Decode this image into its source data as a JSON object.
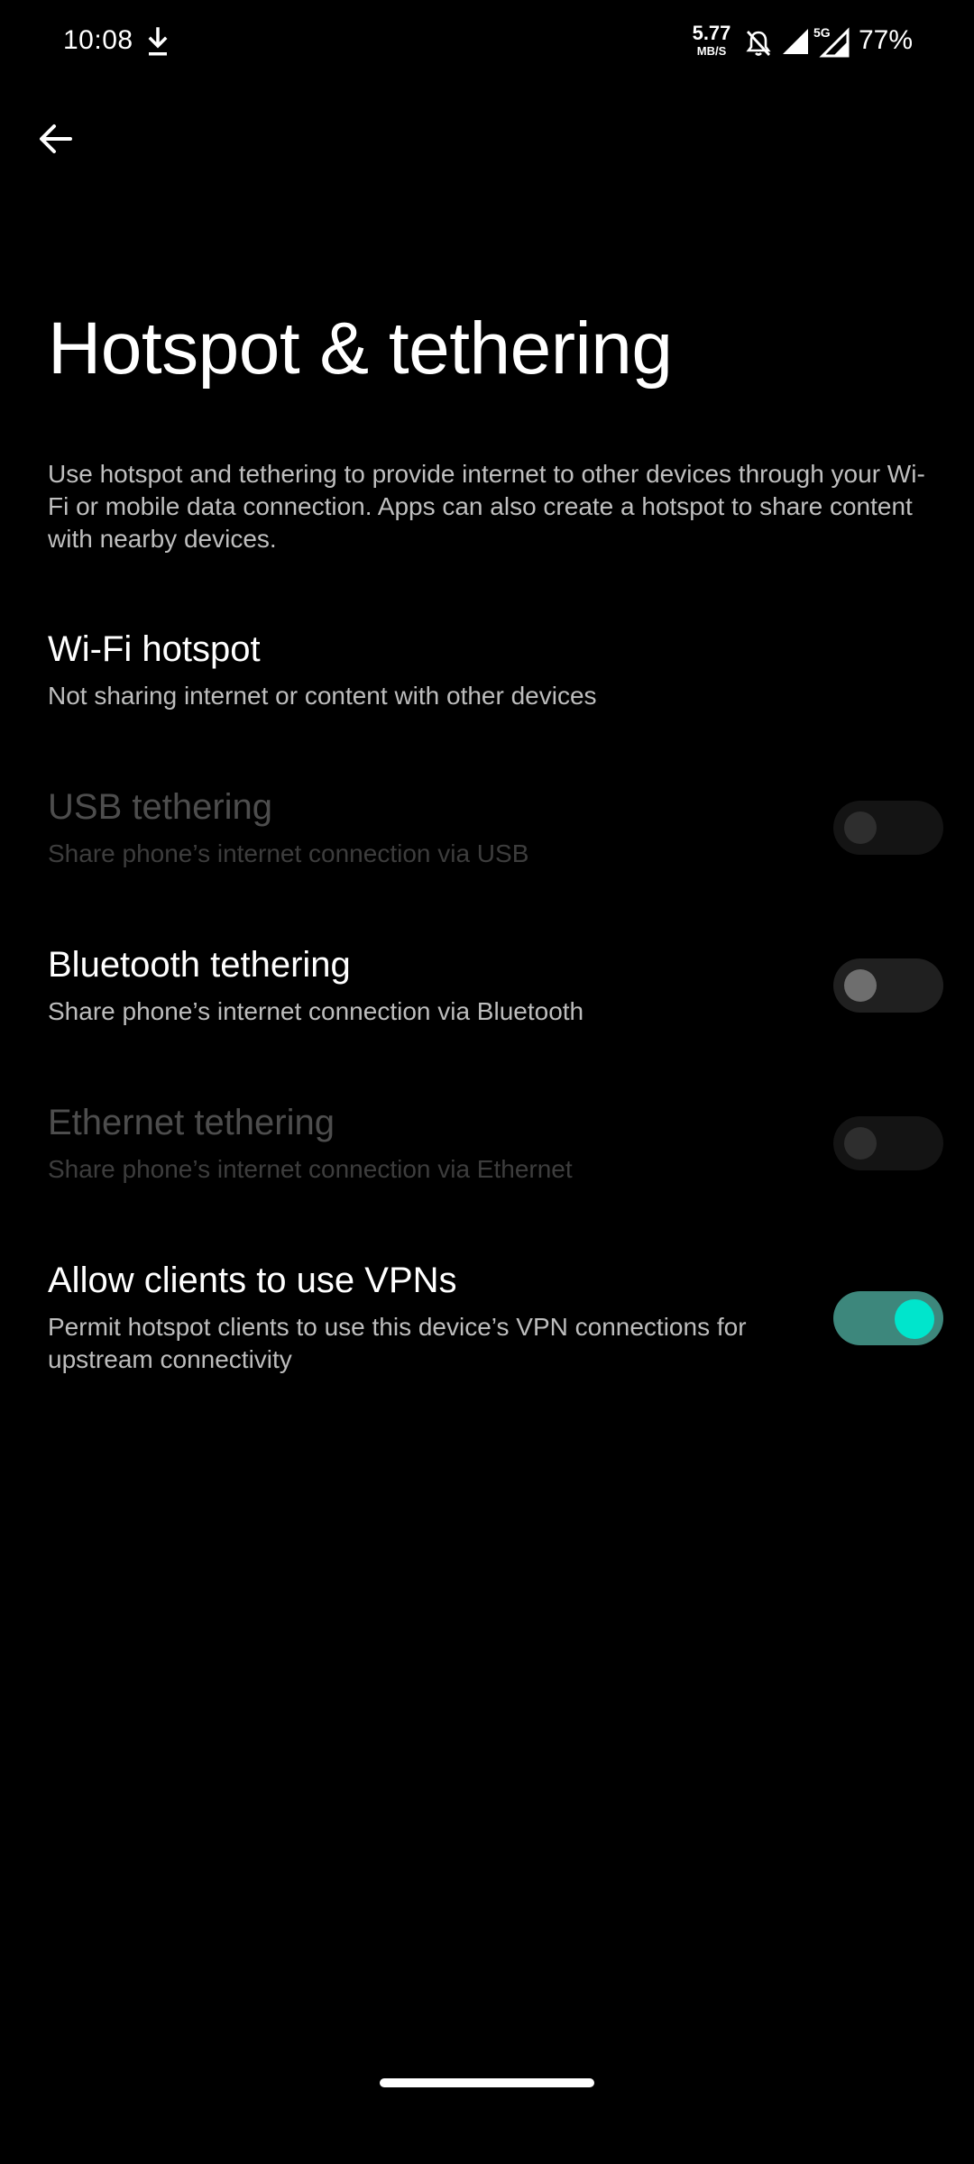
{
  "status_bar": {
    "time": "10:08",
    "speed_value": "5.77",
    "speed_unit": "MB/S",
    "network_type": "5G",
    "battery": "77%",
    "icons": [
      "download-icon",
      "mute-icon",
      "signal-icon",
      "signal-5g-icon"
    ]
  },
  "header": {
    "back_icon": "arrow-back-icon",
    "title": "Hotspot & tethering"
  },
  "description": "Use hotspot and tethering to provide internet to other devices through your Wi-Fi or mobile data connection. Apps can also create a hotspot to share content with nearby devices.",
  "preferences": [
    {
      "title": "Wi-Fi hotspot",
      "summary": "Not sharing internet or content with other devices",
      "enabled": true,
      "has_switch": false
    },
    {
      "title": "USB tethering",
      "summary": "Share phone’s internet connection via USB",
      "enabled": false,
      "has_switch": true,
      "checked": false
    },
    {
      "title": "Bluetooth tethering",
      "summary": "Share phone’s internet connection via Bluetooth",
      "enabled": true,
      "has_switch": true,
      "checked": false
    },
    {
      "title": "Ethernet tethering",
      "summary": "Share phone’s internet connection via Ethernet",
      "enabled": false,
      "has_switch": true,
      "checked": false
    },
    {
      "title": "Allow clients to use VPNs",
      "summary": "Permit hotspot clients to use this device’s VPN connections for upstream connectivity",
      "enabled": true,
      "has_switch": true,
      "checked": true
    }
  ],
  "colors": {
    "background": "#000000",
    "accent_switch_track": "#3d877c",
    "accent_switch_thumb": "#00e5cc",
    "disabled_text": "#4d4d4d"
  }
}
